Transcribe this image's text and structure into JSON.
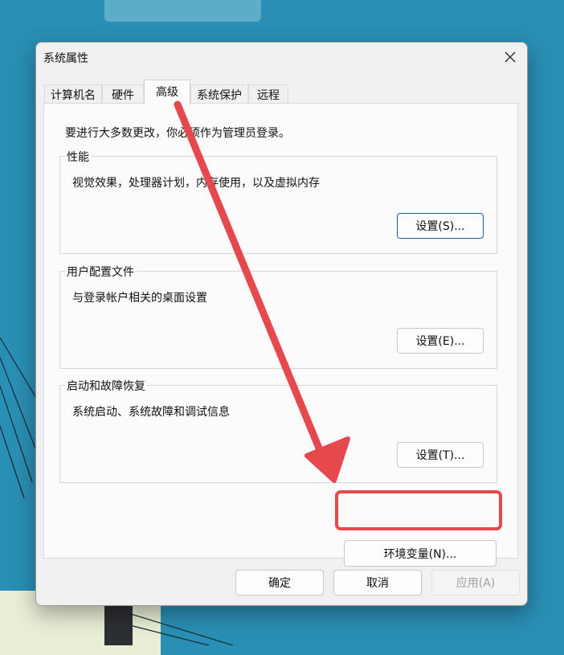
{
  "window": {
    "title": "系统属性"
  },
  "tabs": [
    {
      "label": "计算机名"
    },
    {
      "label": "硬件"
    },
    {
      "label": "高级",
      "selected": true
    },
    {
      "label": "系统保护"
    },
    {
      "label": "远程"
    }
  ],
  "panel": {
    "notice": "要进行大多数更改，你必须作为管理员登录。",
    "groups": [
      {
        "label": "性能",
        "description": "视觉效果，处理器计划，内存使用，以及虚拟内存",
        "button": "设置(S)..."
      },
      {
        "label": "用户配置文件",
        "description": "与登录帐户相关的桌面设置",
        "button": "设置(E)..."
      },
      {
        "label": "启动和故障恢复",
        "description": "系统启动、系统故障和调试信息",
        "button": "设置(T)..."
      }
    ],
    "env_button": "环境变量(N)..."
  },
  "footer": {
    "ok": "确定",
    "cancel": "取消",
    "apply": "应用(A)"
  },
  "annotation": {
    "color": "#e5484d"
  }
}
